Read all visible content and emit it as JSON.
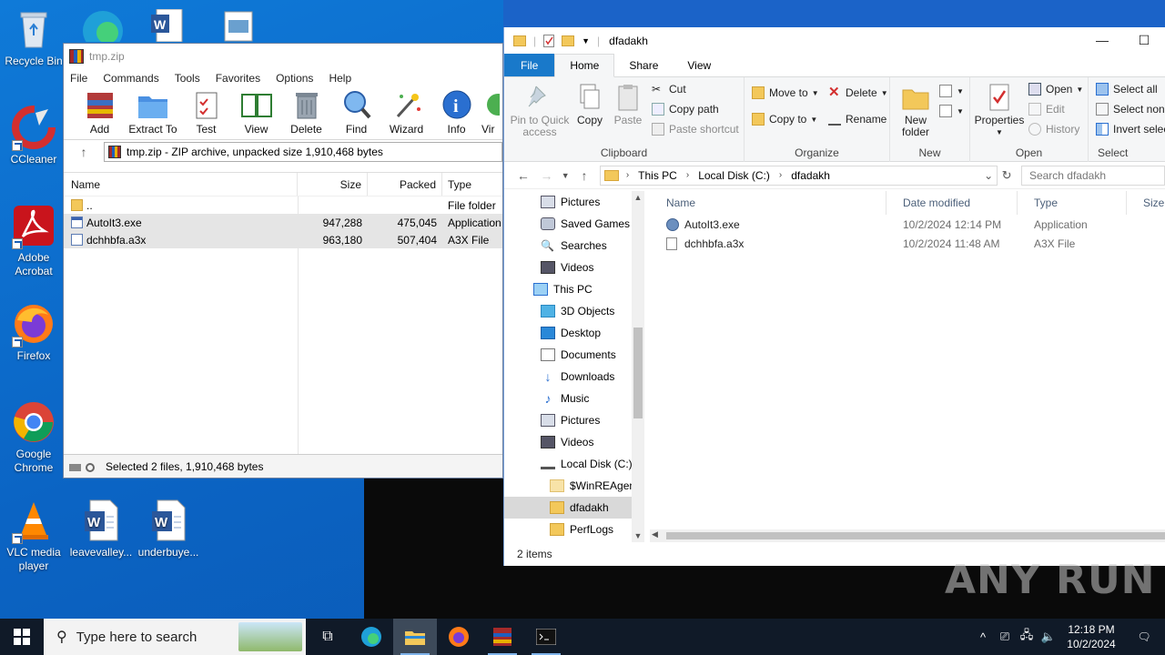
{
  "desktop": {
    "icons": [
      {
        "label": "Recycle Bin"
      },
      {
        "label": "CCleaner"
      },
      {
        "label": "Adobe Acrobat"
      },
      {
        "label": "Firefox"
      },
      {
        "label": "Google Chrome"
      },
      {
        "label": "VLC media player"
      },
      {
        "label": "leavevalley..."
      },
      {
        "label": "underbuye..."
      }
    ]
  },
  "winrar": {
    "title": "tmp.zip",
    "menu": [
      "File",
      "Commands",
      "Tools",
      "Favorites",
      "Options",
      "Help"
    ],
    "toolbar": [
      "Add",
      "Extract To",
      "Test",
      "View",
      "Delete",
      "Find",
      "Wizard",
      "Info",
      "Vir"
    ],
    "address": "tmp.zip - ZIP archive, unpacked size 1,910,468 bytes",
    "columns": {
      "name": "Name",
      "size": "Size",
      "packed": "Packed",
      "type": "Type"
    },
    "rows": [
      {
        "name": "..",
        "size": "",
        "packed": "",
        "type": "File folder"
      },
      {
        "name": "AutoIt3.exe",
        "size": "947,288",
        "packed": "475,045",
        "type": "Application"
      },
      {
        "name": "dchhbfa.a3x",
        "size": "963,180",
        "packed": "507,404",
        "type": "A3X File"
      }
    ],
    "status": "Selected 2 files, 1,910,468 bytes"
  },
  "explorer": {
    "title": "dfadakh",
    "tabs": [
      "File",
      "Home",
      "Share",
      "View"
    ],
    "ribbon": {
      "clipboard": {
        "pin": "Pin to Quick access",
        "copy": "Copy",
        "paste": "Paste",
        "cut": "Cut",
        "copy_path": "Copy path",
        "paste_shortcut": "Paste shortcut",
        "group": "Clipboard"
      },
      "organize": {
        "move_to": "Move to",
        "copy_to": "Copy to",
        "delete": "Delete",
        "rename": "Rename",
        "group": "Organize"
      },
      "new": {
        "new_folder": "New folder",
        "group": "New"
      },
      "open": {
        "properties": "Properties",
        "open": "Open",
        "edit": "Edit",
        "history": "History",
        "group": "Open"
      },
      "select": {
        "select_all": "Select all",
        "select_none": "Select none",
        "invert": "Invert selec",
        "group": "Select"
      }
    },
    "breadcrumb": [
      "This PC",
      "Local Disk (C:)",
      "dfadakh"
    ],
    "search_placeholder": "Search dfadakh",
    "nav": [
      {
        "label": "Pictures",
        "indent": 2
      },
      {
        "label": "Saved Games",
        "indent": 2
      },
      {
        "label": "Searches",
        "indent": 2
      },
      {
        "label": "Videos",
        "indent": 2
      },
      {
        "label": "This PC",
        "indent": 1
      },
      {
        "label": "3D Objects",
        "indent": 2
      },
      {
        "label": "Desktop",
        "indent": 2
      },
      {
        "label": "Documents",
        "indent": 2
      },
      {
        "label": "Downloads",
        "indent": 2
      },
      {
        "label": "Music",
        "indent": 2
      },
      {
        "label": "Pictures",
        "indent": 2
      },
      {
        "label": "Videos",
        "indent": 2
      },
      {
        "label": "Local Disk (C:)",
        "indent": 2
      },
      {
        "label": "$WinREAgent",
        "indent": 3
      },
      {
        "label": "dfadakh",
        "indent": 3,
        "selected": true
      },
      {
        "label": "PerfLogs",
        "indent": 3
      }
    ],
    "columns": {
      "name": "Name",
      "date": "Date modified",
      "type": "Type",
      "size": "Size"
    },
    "files": [
      {
        "name": "AutoIt3.exe",
        "date": "10/2/2024 12:14 PM",
        "type": "Application"
      },
      {
        "name": "dchhbfa.a3x",
        "date": "10/2/2024 11:48 AM",
        "type": "A3X File"
      }
    ],
    "status": "2 items"
  },
  "watermark": "ANY RUN",
  "taskbar": {
    "search_placeholder": "Type here to search",
    "time": "12:18 PM",
    "date": "10/2/2024"
  }
}
